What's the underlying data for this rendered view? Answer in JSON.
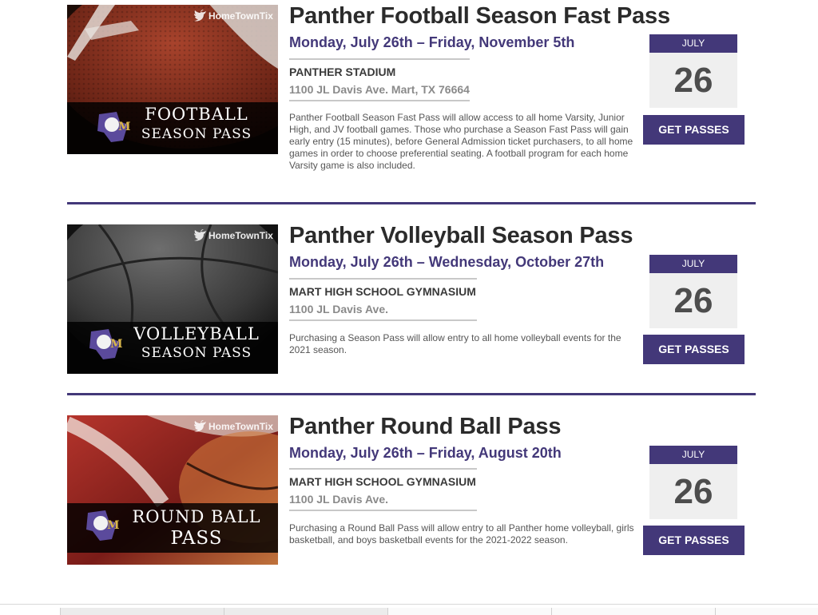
{
  "events": [
    {
      "watermark": "HomeTownTix",
      "banner_line1": "FOOTBALL",
      "banner_line2": "SEASON PASS",
      "title": "Panther Football Season Fast Pass",
      "dates": "Monday, July 26th – Friday, November 5th",
      "venue": "PANTHER STADIUM",
      "address": "1100 JL Davis Ave. Mart, TX 76664",
      "description": "Panther Football Season Fast Pass will allow access to all home Varsity, Junior High, and JV football games. Those who purchase a Season Fast Pass will gain early entry (15 minutes), before General Admission ticket purchasers, to all home games in order to choose preferential seating. A football program for each home Varsity game is also included.",
      "month": "JULY",
      "day": "26",
      "button": "GET PASSES"
    },
    {
      "watermark": "HomeTownTix",
      "banner_line1": "VOLLEYBALL",
      "banner_line2": "SEASON PASS",
      "title": "Panther Volleyball Season Pass",
      "dates": "Monday, July 26th – Wednesday, October 27th",
      "venue": "MART HIGH SCHOOL GYMNASIUM",
      "address": "1100 JL Davis Ave.",
      "description": "Purchasing a Season Pass will allow entry to all home volleyball events for the 2021 season.",
      "month": "JULY",
      "day": "26",
      "button": "GET PASSES"
    },
    {
      "watermark": "HomeTownTix",
      "banner_line1": "ROUND BALL",
      "banner_line2": "PASS",
      "title": "Panther Round Ball Pass",
      "dates": "Monday, July 26th – Friday, August 20th",
      "venue": "MART HIGH SCHOOL GYMNASIUM",
      "address": "1100 JL Davis Ave.",
      "description": "Purchasing a Round Ball Pass will allow entry to all Panther home volleyball, girls basketball, and boys basketball events for the 2021-2022 season.",
      "month": "JULY",
      "day": "26",
      "button": "GET PASSES"
    }
  ],
  "colors": {
    "accent": "#433879",
    "calendar_bg": "#efefef",
    "title_text": "#2b2b2b"
  },
  "logo_letter": "M"
}
